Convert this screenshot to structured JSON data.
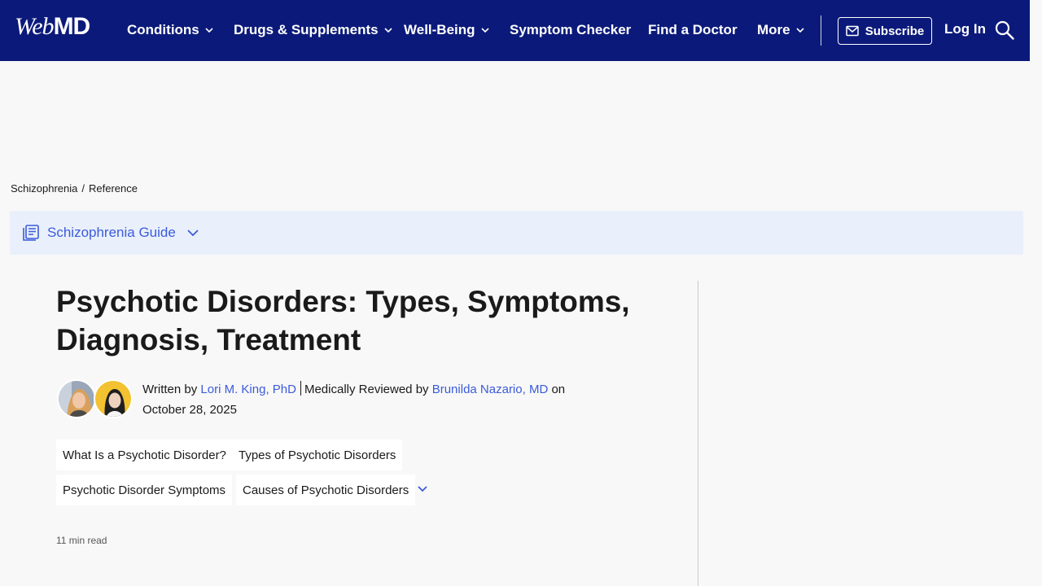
{
  "header": {
    "logo": {
      "prefix": "Web",
      "suffix": "MD"
    },
    "nav": [
      {
        "label": "Conditions",
        "dropdown": true
      },
      {
        "label": "Drugs & Supplements",
        "dropdown": true
      },
      {
        "label": "Well-Being",
        "dropdown": true
      },
      {
        "label": "Symptom Checker",
        "dropdown": false
      },
      {
        "label": "Find a Doctor",
        "dropdown": false
      },
      {
        "label": "More",
        "dropdown": true
      }
    ],
    "subscribe_label": "Subscribe",
    "login_label": "Log In",
    "search_icon": "search-icon"
  },
  "breadcrumb": {
    "items": [
      "Schizophrenia",
      "Reference"
    ],
    "separator": "/"
  },
  "guide": {
    "title": "Schizophrenia Guide",
    "icon": "guide-icon"
  },
  "article": {
    "title": "Psychotic Disorders: Types, Symptoms, Diagnosis, Treatment",
    "byline": {
      "written_prefix": "Written by",
      "author": "Lori M. King, PhD",
      "reviewed_prefix": "Medically Reviewed by",
      "reviewer": "Brunilda Nazario, MD",
      "date_prefix": "on",
      "date": "October 28, 2025"
    },
    "toc": [
      "What Is a Psychotic Disorder?",
      "Types of Psychotic Disorders",
      "Psychotic Disorder Symptoms",
      "Causes of Psychotic Disorders"
    ],
    "read_time": "11 min read"
  },
  "colors": {
    "nav_bg": "#0b1a7a",
    "link": "#3b5bdb",
    "guide_bg": "#eaf0fb",
    "page_bg": "#f8f8f8"
  }
}
